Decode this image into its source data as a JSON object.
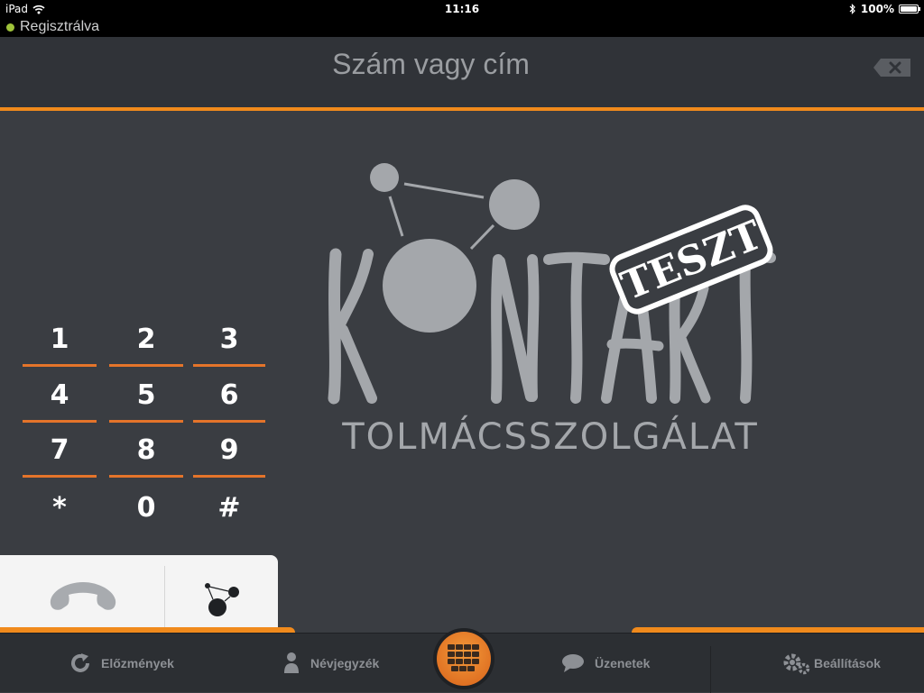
{
  "status_bar": {
    "device": "iPad",
    "time": "11:16",
    "battery": "100%"
  },
  "registration": {
    "status": "Regisztrálva"
  },
  "header": {
    "placeholder": "Szám vagy cím"
  },
  "logo": {
    "brand": "KONTAKT",
    "subtitle": "TOLMÁCSSZOLGÁLAT",
    "stamp": "TESZT"
  },
  "keypad": {
    "keys": [
      "1",
      "2",
      "3",
      "4",
      "5",
      "6",
      "7",
      "8",
      "9",
      "*",
      "0",
      "#"
    ]
  },
  "tabs": {
    "history": "Előzmények",
    "contacts": "Névjegyzék",
    "messages": "Üzenetek",
    "settings": "Beállítások"
  },
  "colors": {
    "accent": "#f08a1c",
    "background": "#3a3d42",
    "logo": "#a4a7ab",
    "registered": "#9fc33a"
  }
}
